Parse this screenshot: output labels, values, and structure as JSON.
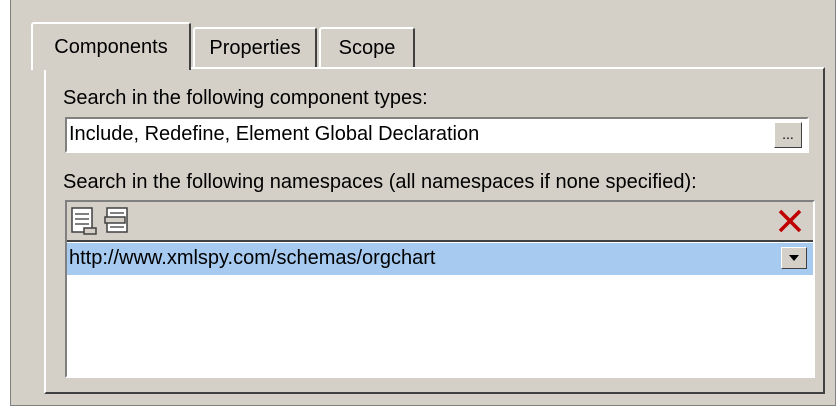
{
  "tabs": [
    {
      "label": "Components",
      "active": true
    },
    {
      "label": "Properties",
      "active": false
    },
    {
      "label": "Scope",
      "active": false
    }
  ],
  "component_types": {
    "label": "Search in the following component types:",
    "value": "Include, Redefine, Element Global Declaration",
    "browse_label": "..."
  },
  "namespaces": {
    "label": "Search in the following namespaces (all namespaces if none specified):",
    "toolbar": {
      "append_icon": "append-row-icon",
      "insert_icon": "insert-row-icon",
      "delete_icon": "delete-x-icon"
    },
    "rows": [
      {
        "value": "http://www.xmlspy.com/schemas/orgchart",
        "selected": true
      }
    ]
  },
  "colors": {
    "dialog_bg": "#d4d0c8",
    "selection": "#a6caf0",
    "delete_red": "#c00000"
  }
}
